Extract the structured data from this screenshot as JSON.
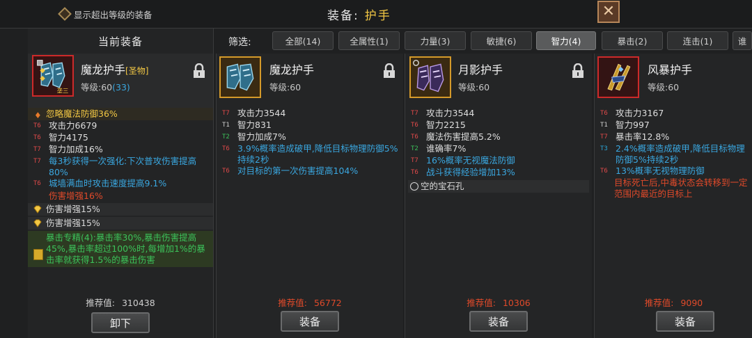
{
  "topbar": {
    "show_over_level_label": "显示超出等级的装备",
    "title_label": "装备:",
    "title_value": "护手"
  },
  "current": {
    "header": "当前装备",
    "item": {
      "name": "魔龙护手",
      "quality_tag": "[圣物]",
      "level_label": "等级:60",
      "level_bonus": "(33)",
      "icon_badge": "垄三"
    },
    "special_line": "忽略魔法防御36%",
    "stats": [
      {
        "tier": "T6",
        "text": "攻击力6679",
        "cls": "t6",
        "color": "normal"
      },
      {
        "tier": "T6",
        "text": "智力4175",
        "cls": "t6",
        "color": "normal"
      },
      {
        "tier": "T7",
        "text": "智力加成16%",
        "cls": "t7",
        "color": "normal"
      },
      {
        "tier": "T7",
        "text": "每3秒获得一次强化:下次普攻伤害提高80%",
        "cls": "t7",
        "color": "blue"
      },
      {
        "tier": "T6",
        "text": "城墙满血时攻击速度提高9.1%",
        "cls": "t6",
        "color": "blue"
      }
    ],
    "red_line": "伤害增强16%",
    "gem_lines": [
      "伤害增强15%",
      "伤害增强15%"
    ],
    "spec_text": "暴击专精(4):暴击率30%,暴击伤害提高45%,暴击率超过100%时,每增加1%的暴击率就获得1.5%的暴击伤害",
    "rec_label": "推荐值:",
    "rec_value": "310438",
    "unequip_button": "卸下"
  },
  "filter": {
    "label": "筛选:",
    "tabs": [
      "全部(14)",
      "全属性(1)",
      "力量(3)",
      "敏捷(6)",
      "智力(4)",
      "暴击(2)",
      "连击(1)",
      "谁"
    ],
    "active_index": 4
  },
  "compare": [
    {
      "name": "魔龙护手",
      "level": "等级:60",
      "stats": [
        {
          "tier": "T7",
          "cls": "t7",
          "text": "攻击力3544",
          "color": "normal"
        },
        {
          "tier": "T1",
          "cls": "t1",
          "text": "智力831",
          "color": "normal"
        },
        {
          "tier": "T2",
          "cls": "t2",
          "text": "智力加成7%",
          "color": "normal"
        },
        {
          "tier": "T6",
          "cls": "t6",
          "text": "3.9%概率造成破甲,降低目标物理防御5%持续2秒",
          "color": "blue"
        },
        {
          "tier": "T6",
          "cls": "t6",
          "text": "对目标的第一次伤害提高104%",
          "color": "blue"
        }
      ],
      "rec_label": "推荐值:",
      "rec_value": "56772",
      "equip_button": "装备"
    },
    {
      "name": "月影护手",
      "level": "等级:60",
      "stats": [
        {
          "tier": "T7",
          "cls": "t7",
          "text": "攻击力3544",
          "color": "normal"
        },
        {
          "tier": "T6",
          "cls": "t6",
          "text": "智力2215",
          "color": "normal"
        },
        {
          "tier": "T6",
          "cls": "t6",
          "text": "魔法伤害提高5.2%",
          "color": "normal"
        },
        {
          "tier": "T2",
          "cls": "t2",
          "text": "谁确率7%",
          "color": "normal"
        },
        {
          "tier": "T7",
          "cls": "t7",
          "text": "16%概率无视魔法防御",
          "color": "blue"
        },
        {
          "tier": "T6",
          "cls": "t6",
          "text": "战斗获得经验增加13%",
          "color": "blue"
        }
      ],
      "gem_slot": "空的宝石孔",
      "rec_label": "推荐值:",
      "rec_value": "10306",
      "equip_button": "装备"
    },
    {
      "name": "风暴护手",
      "level": "等级:60",
      "stats": [
        {
          "tier": "T6",
          "cls": "t6",
          "text": "攻击力3167",
          "color": "normal"
        },
        {
          "tier": "T1",
          "cls": "t1",
          "text": "智力997",
          "color": "normal"
        },
        {
          "tier": "T7",
          "cls": "t7",
          "text": "暴击率12.8%",
          "color": "normal"
        },
        {
          "tier": "T3",
          "cls": "t3",
          "text": "2.4%概率造成破甲,降低目标物理防御5%持续2秒",
          "color": "blue"
        },
        {
          "tier": "T6",
          "cls": "t6",
          "text": "13%概率无视物理防御",
          "color": "blue"
        }
      ],
      "red_text": "目标死亡后,中毒状态会转移到一定范围内最近的目标上",
      "rec_label": "推荐值:",
      "rec_value": "9090",
      "equip_button": "装备"
    }
  ]
}
